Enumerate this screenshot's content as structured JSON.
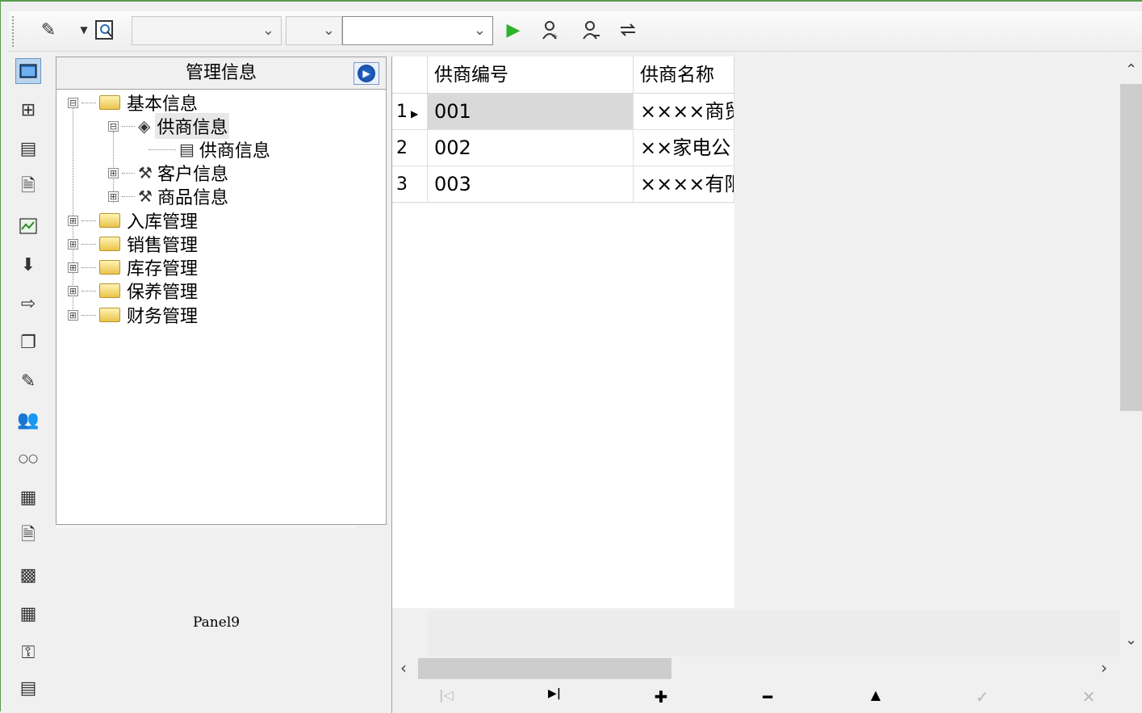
{
  "toolbar": {
    "icons": [
      "pencil-icon",
      "dropdown-arrow-icon",
      "search-doc-icon",
      "run-icon",
      "find-icon",
      "filter-icon",
      "refresh-icon"
    ],
    "combo1_value": "",
    "combo2_value": "",
    "combo3_value": ""
  },
  "sidebar": {
    "icons": [
      "window-icon",
      "tree-icon",
      "form-icon",
      "document-icon",
      "chart-icon",
      "download-icon",
      "export-icon",
      "copy-icon",
      "edit-icon",
      "users-icon",
      "link-icon",
      "report-icon",
      "report2-icon",
      "table-icon",
      "grid-icon",
      "key-icon",
      "panel-icon"
    ]
  },
  "tree": {
    "title": "管理信息",
    "nodes": [
      {
        "label": "基本信息",
        "expander": "⊟"
      },
      {
        "label": "供商信息",
        "expander": "⊟"
      },
      {
        "label": "供商信息"
      },
      {
        "label": "客户信息",
        "expander": "⊞"
      },
      {
        "label": "商品信息",
        "expander": "⊞"
      },
      {
        "label": "入库管理",
        "expander": "⊞"
      },
      {
        "label": "销售管理",
        "expander": "⊞"
      },
      {
        "label": "库存管理",
        "expander": "⊞"
      },
      {
        "label": "保养管理",
        "expander": "⊞"
      },
      {
        "label": "财务管理",
        "expander": "⊞"
      }
    ]
  },
  "panel9": {
    "label": "Panel9"
  },
  "grid": {
    "columns": [
      "供商编号",
      "供商名称"
    ],
    "rows": [
      {
        "num": "1",
        "code": "001",
        "name": "××××商贸"
      },
      {
        "num": "2",
        "code": "002",
        "name": "××家电公"
      },
      {
        "num": "3",
        "code": "003",
        "name": "××××有限"
      }
    ],
    "current_row_marker": "▶"
  },
  "navigator": {
    "first": "|◁",
    "last": "▶|",
    "insert": "✚",
    "delete": "━",
    "edit": "▲",
    "post": "✓",
    "cancel": "✕"
  }
}
